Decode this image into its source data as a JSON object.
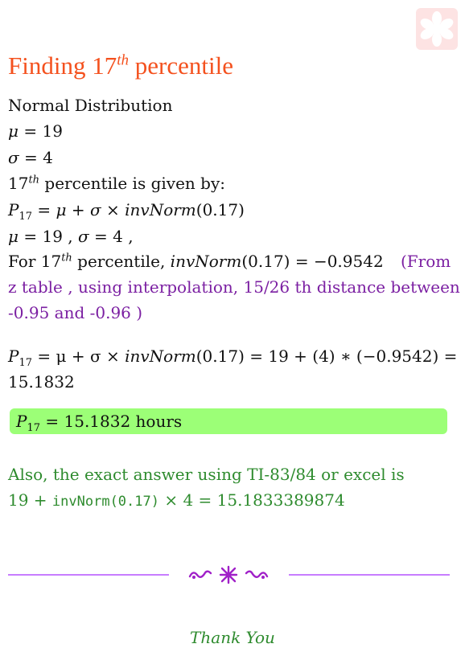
{
  "logo": {
    "icon": "star-flower-logo-icon",
    "color": "#f6a5a5"
  },
  "title": {
    "prefix": "Finding 17",
    "sup": "th",
    "suffix": " percentile"
  },
  "lines": {
    "distribution": "Normal Distribution",
    "mu_var": "μ",
    "mu_rhs": " = 19",
    "sigma_var": "σ",
    "sigma_rhs": " = 4",
    "pct_base": "17",
    "pct_sup": "th",
    "pct_text": " percentile is given by:",
    "formula_P": "P",
    "formula_sub": "17",
    "formula_eq": " = ",
    "formula_mu": "μ",
    "formula_plus": " + ",
    "formula_sigma": "σ",
    "formula_times": " × ",
    "formula_fn": "invNorm",
    "formula_arg": "(0.17)",
    "params_mu": "μ",
    "params_mu_val": " = 19 , ",
    "params_sigma": "σ",
    "params_sigma_val": " = 4 ,",
    "for_text": "For 17",
    "for_sup": "th",
    "for_text2": " percentile, ",
    "for_fn": "invNorm",
    "for_val": "(0.17) = −0.9542",
    "note_1": "(From",
    "note_2": "z table , using interpolation, 15/26 th distance between",
    "note_3": "-0.95 and -0.96 )",
    "calc_P": "P",
    "calc_sub": "17",
    "calc_mid": " = μ + σ × ",
    "calc_fn": "invNorm",
    "calc_rest": "(0.17) = 19 + (4) ∗ (−0.9542) =",
    "calc_result": "15.1832"
  },
  "result": {
    "P": "P",
    "sub": "17",
    "text": " = 15.1832 hours",
    "bg": "#9cff77"
  },
  "exact": {
    "line1": "Also, the exact answer using TI-83/84 or excel is",
    "prefix": "19 + ",
    "code": "invNorm(0.17)",
    "suffix": " × 4 = 15.1833389874"
  },
  "divider": {
    "icon": "flourish-ornament-icon",
    "color": "#c77dff"
  },
  "footer": {
    "thanks": "Thank You"
  }
}
